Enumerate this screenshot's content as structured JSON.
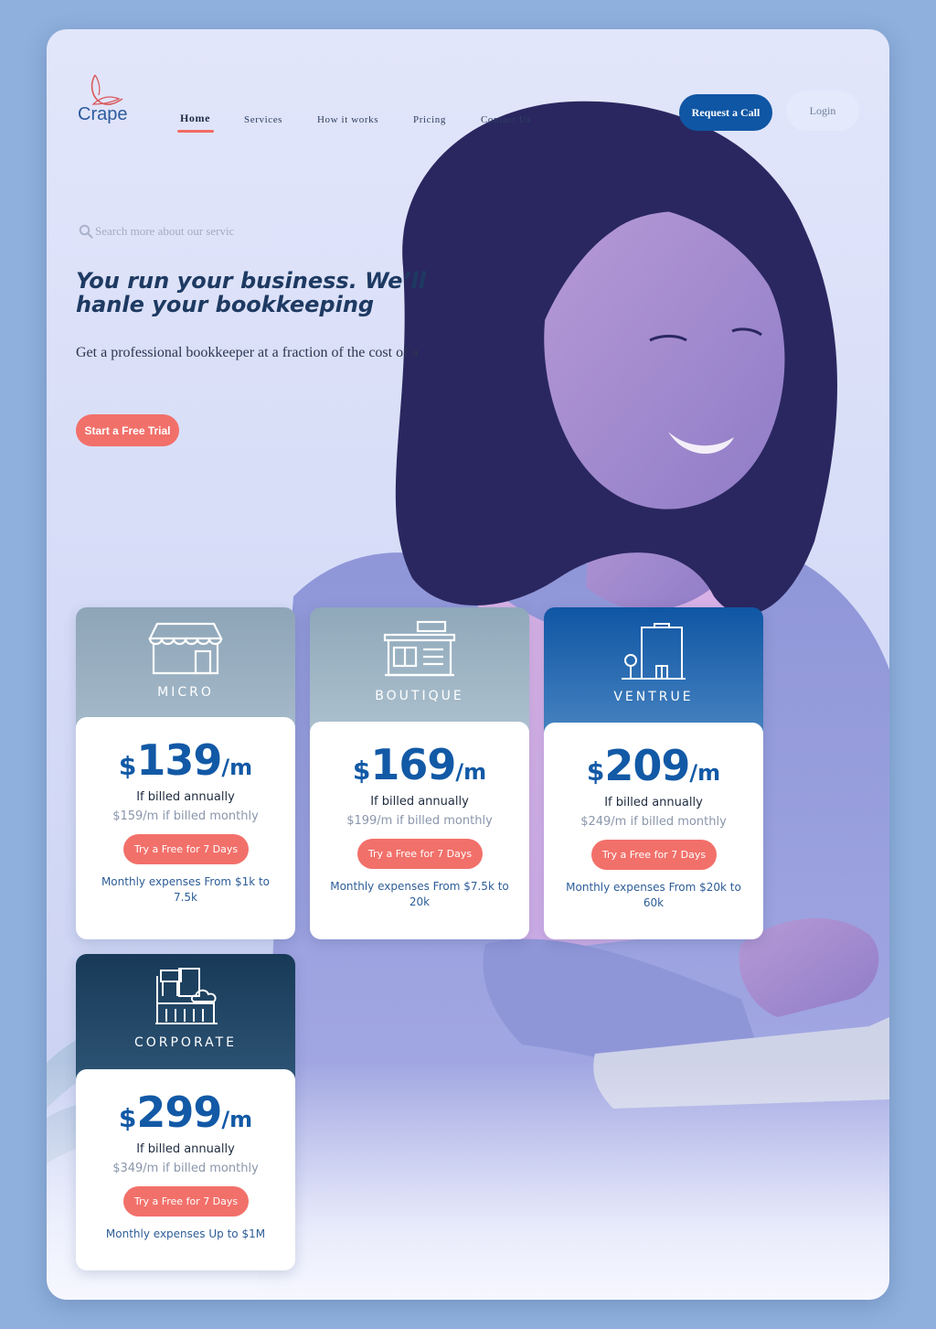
{
  "brand": {
    "name": "Crape",
    "logo_icon": "ribbon-logo"
  },
  "nav": {
    "items": [
      {
        "label": "Home",
        "active": true
      },
      {
        "label": "Services",
        "active": false
      },
      {
        "label": "How it works",
        "active": false
      },
      {
        "label": "Pricing",
        "active": false
      },
      {
        "label": "Contact Us",
        "active": false
      }
    ]
  },
  "header": {
    "request_call_label": "Request a Call",
    "login_label": "Login"
  },
  "search": {
    "placeholder": "Search more about our servic",
    "icon": "search-icon"
  },
  "hero": {
    "headline": "You run your business. We’ll hanle your bookkeeping",
    "subtext": "Get a professional bookkeeper at a fraction of the cost of a",
    "cta_label": "Start a Free Trial"
  },
  "plans": [
    {
      "name": "MICRO",
      "icon": "storefront-icon",
      "currency": "$",
      "price": "139",
      "per": "/m",
      "billed": "If billed annually",
      "monthly": "$159/m if billed monthly",
      "cta": "Try a Free for 7 Days",
      "expenses": "Monthly expenses From $1k to 7.5k"
    },
    {
      "name": "BOUTIQUE",
      "icon": "boutique-shop-icon",
      "currency": "$",
      "price": "169",
      "per": "/m",
      "billed": "If billed annually",
      "monthly": "$199/m if billed monthly",
      "cta": "Try a Free for 7 Days",
      "expenses": "Monthly expenses From $7.5k to 20k"
    },
    {
      "name": "VENTRUE",
      "icon": "office-building-icon",
      "currency": "$",
      "price": "209",
      "per": "/m",
      "billed": "If billed annually",
      "monthly": "$249/m if billed monthly",
      "cta": "Try a Free for 7 Days",
      "expenses": "Monthly expenses From $20k to 60k"
    },
    {
      "name": "CORPORATE",
      "icon": "corporate-buildings-icon",
      "currency": "$",
      "price": "299",
      "per": "/m",
      "billed": "If billed annually",
      "monthly": "$349/m if billed monthly",
      "cta": "Try a Free for 7 Days",
      "expenses": "Monthly expenses Up to $1M"
    }
  ],
  "colors": {
    "primary": "#0f56a4",
    "accent": "#f2706a",
    "heading": "#1e3a62",
    "micro_header": "#8ea5b8",
    "boutique_header": "#9ab2c2",
    "ventrue_header": "#1a5fa8",
    "corporate_header": "#1f4260"
  }
}
